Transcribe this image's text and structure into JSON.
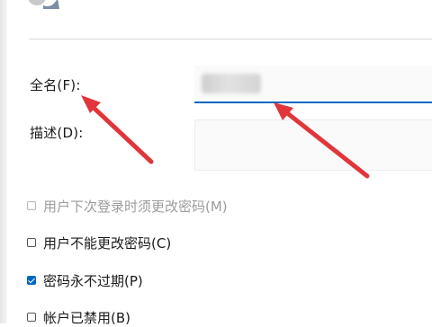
{
  "form": {
    "fullname_label": "全名(F):",
    "fullname_value": "",
    "description_label": "描述(D):",
    "description_value": ""
  },
  "options": [
    {
      "label": "用户下次登录时须更改密码(M)",
      "checked": false,
      "disabled": true
    },
    {
      "label": "用户不能更改密码(C)",
      "checked": false,
      "disabled": false
    },
    {
      "label": "密码永不过期(P)",
      "checked": true,
      "disabled": false
    },
    {
      "label": "帐户已禁用(B)",
      "checked": false,
      "disabled": false
    }
  ],
  "colors": {
    "accent": "#0067c0",
    "annotation_arrow": "#e0363b"
  }
}
